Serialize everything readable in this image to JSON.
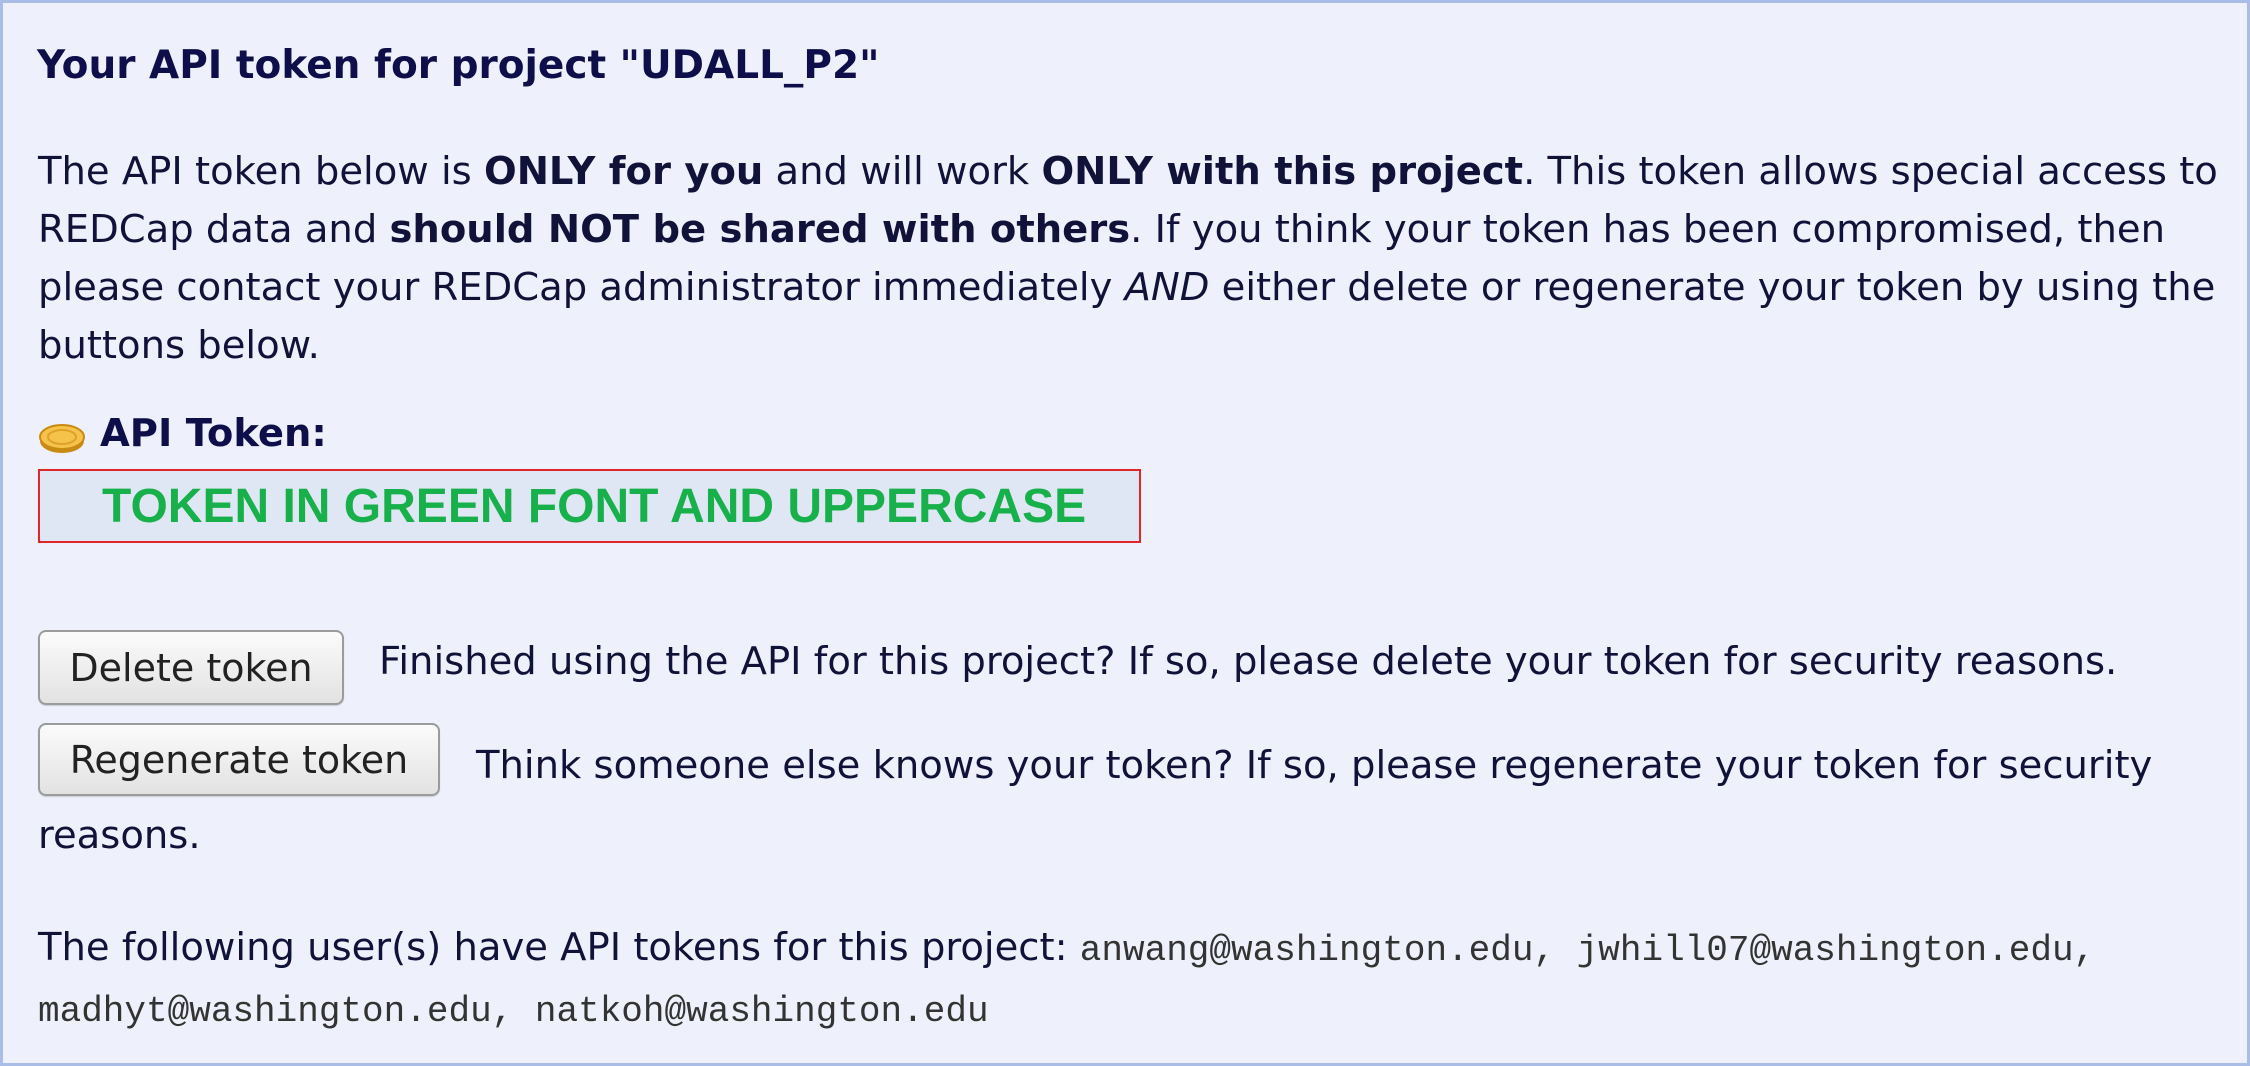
{
  "title": "Your API token for project \"UDALL_P2\"",
  "intro": {
    "p1": "The API token below is ",
    "b1": "ONLY for you",
    "p2": " and will work ",
    "b2": "ONLY with this project",
    "p3": ". This token allows special access to REDCap data and ",
    "b3": "should NOT be shared with others",
    "p4": ". If you think your token has been compromised, then please contact your REDCap administrator immediately ",
    "i1": "AND",
    "p5": " either delete or regenerate your token by using the buttons below."
  },
  "token": {
    "icon": "coin-icon",
    "label": "API Token:",
    "value": "TOKEN IN GREEN FONT AND UPPERCASE",
    "value_color": "#17b04b",
    "box_border_color": "#e0262b"
  },
  "actions": {
    "delete_label": "Delete token",
    "delete_desc": "Finished using the API for this project? If so, please delete your token for security reasons.",
    "regenerate_label": "Regenerate token",
    "regenerate_desc": "Think someone else knows your token? If so, please regenerate your token for security reasons."
  },
  "users": {
    "label": "The following user(s) have API tokens for this project: ",
    "list": "anwang@washington.edu, jwhill07@washington.edu, madhyt@washington.edu, natkoh@washington.edu"
  },
  "colors": {
    "background": "#eef0fb",
    "border": "#a9bde6",
    "text": "#10123a"
  }
}
